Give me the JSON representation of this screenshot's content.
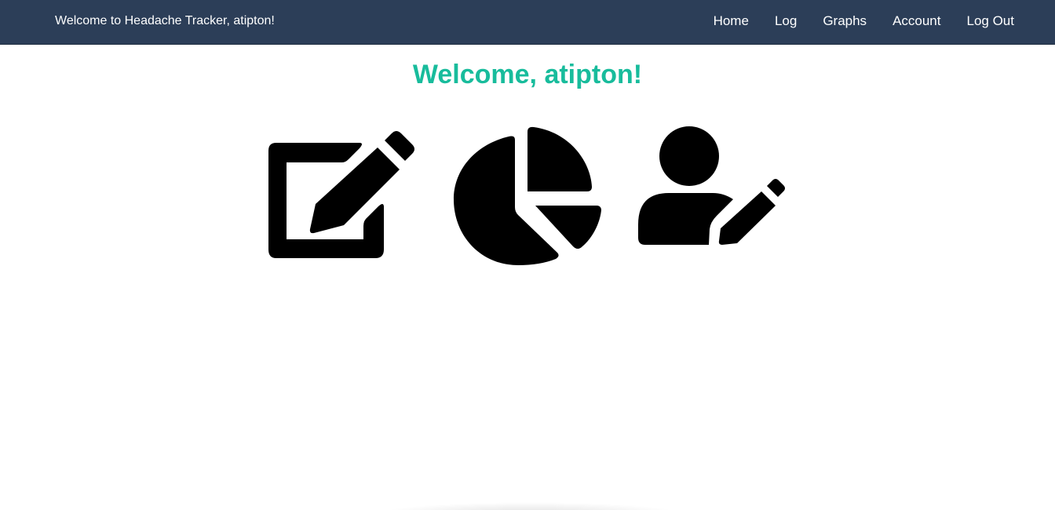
{
  "header": {
    "brand": "Welcome to Headache Tracker, atipton!",
    "nav": [
      {
        "label": "Home"
      },
      {
        "label": "Log"
      },
      {
        "label": "Graphs"
      },
      {
        "label": "Account"
      },
      {
        "label": "Log Out"
      }
    ]
  },
  "main": {
    "title": "Welcome, atipton!",
    "tiles": [
      {
        "icon": "edit-icon"
      },
      {
        "icon": "pie-chart-icon"
      },
      {
        "icon": "user-edit-icon"
      }
    ]
  },
  "colors": {
    "navbar": "#2c3e58",
    "title": "#18bc9c",
    "icon": "#000000"
  }
}
